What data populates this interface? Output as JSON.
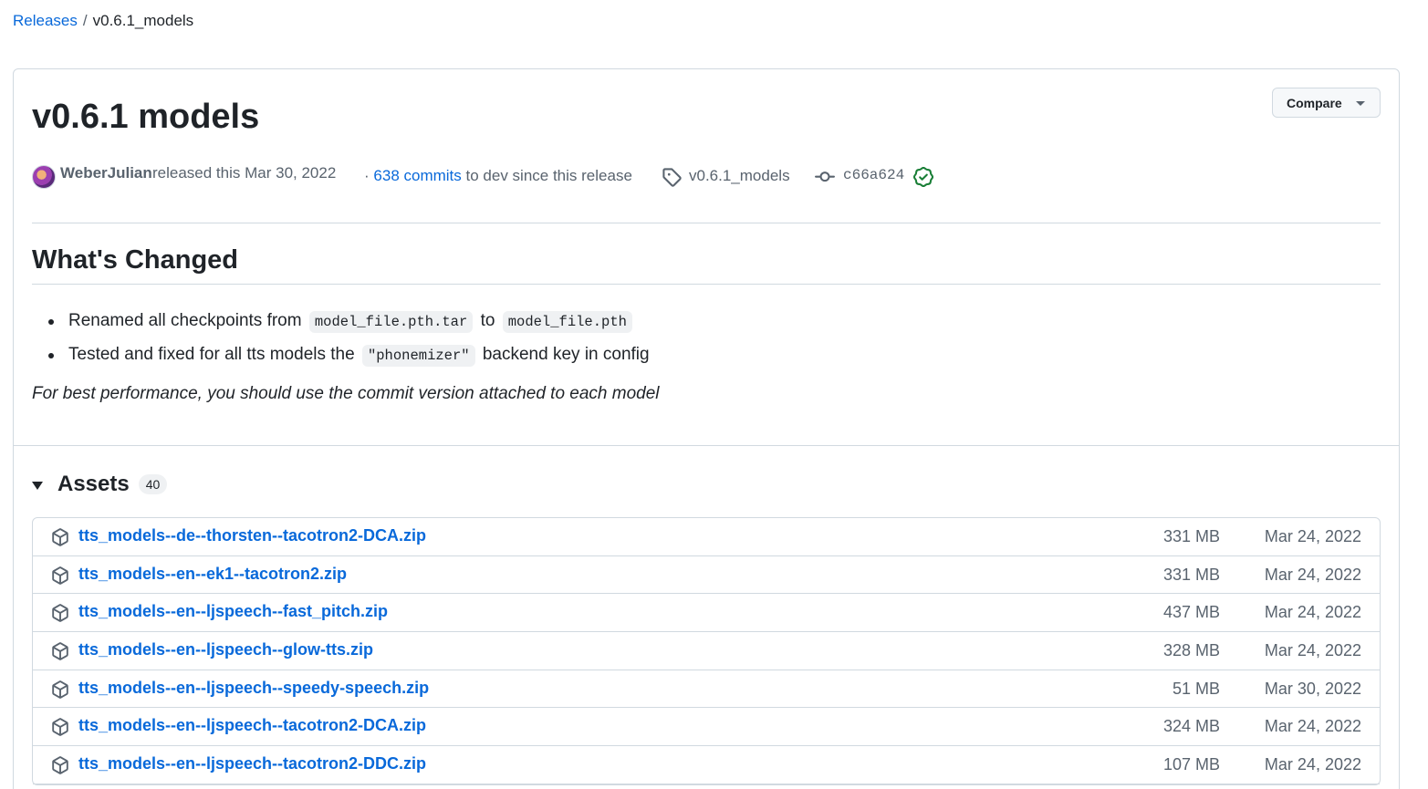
{
  "breadcrumb": {
    "root": "Releases",
    "separator": "/",
    "current": "v0.6.1_models"
  },
  "release": {
    "title": "v0.6.1 models",
    "compare_label": "Compare",
    "author": "WeberJulian",
    "released_text": "released this Mar 30, 2022",
    "commits_link": "638 commits",
    "commits_suffix": "to dev since this release",
    "commits_prefix": "·",
    "tag": "v0.6.1_models",
    "commit_sha": "c66a624"
  },
  "body": {
    "heading": "What's Changed",
    "items": [
      {
        "pre": "Renamed all checkpoints from",
        "code1": "model_file.pth.tar",
        "mid": "to",
        "code2": "model_file.pth",
        "post": ""
      },
      {
        "pre": "Tested and fixed for all tts models the",
        "code1": "\"phonemizer\"",
        "mid": "backend key in config",
        "code2": "",
        "post": ""
      }
    ],
    "note": "For best performance, you should use the commit version attached to each model"
  },
  "assets": {
    "title": "Assets",
    "count": "40",
    "rows": [
      {
        "name": "tts_models--de--thorsten--tacotron2-DCA.zip",
        "size": "331 MB",
        "date": "Mar 24, 2022"
      },
      {
        "name": "tts_models--en--ek1--tacotron2.zip",
        "size": "331 MB",
        "date": "Mar 24, 2022"
      },
      {
        "name": "tts_models--en--ljspeech--fast_pitch.zip",
        "size": "437 MB",
        "date": "Mar 24, 2022"
      },
      {
        "name": "tts_models--en--ljspeech--glow-tts.zip",
        "size": "328 MB",
        "date": "Mar 24, 2022"
      },
      {
        "name": "tts_models--en--ljspeech--speedy-speech.zip",
        "size": "51 MB",
        "date": "Mar 30, 2022"
      },
      {
        "name": "tts_models--en--ljspeech--tacotron2-DCA.zip",
        "size": "324 MB",
        "date": "Mar 24, 2022"
      },
      {
        "name": "tts_models--en--ljspeech--tacotron2-DDC.zip",
        "size": "107 MB",
        "date": "Mar 24, 2022"
      }
    ]
  },
  "colors": {
    "link": "#0969da",
    "muted": "#59636e",
    "border": "#d1d9e0",
    "verified": "#1a7f37"
  }
}
